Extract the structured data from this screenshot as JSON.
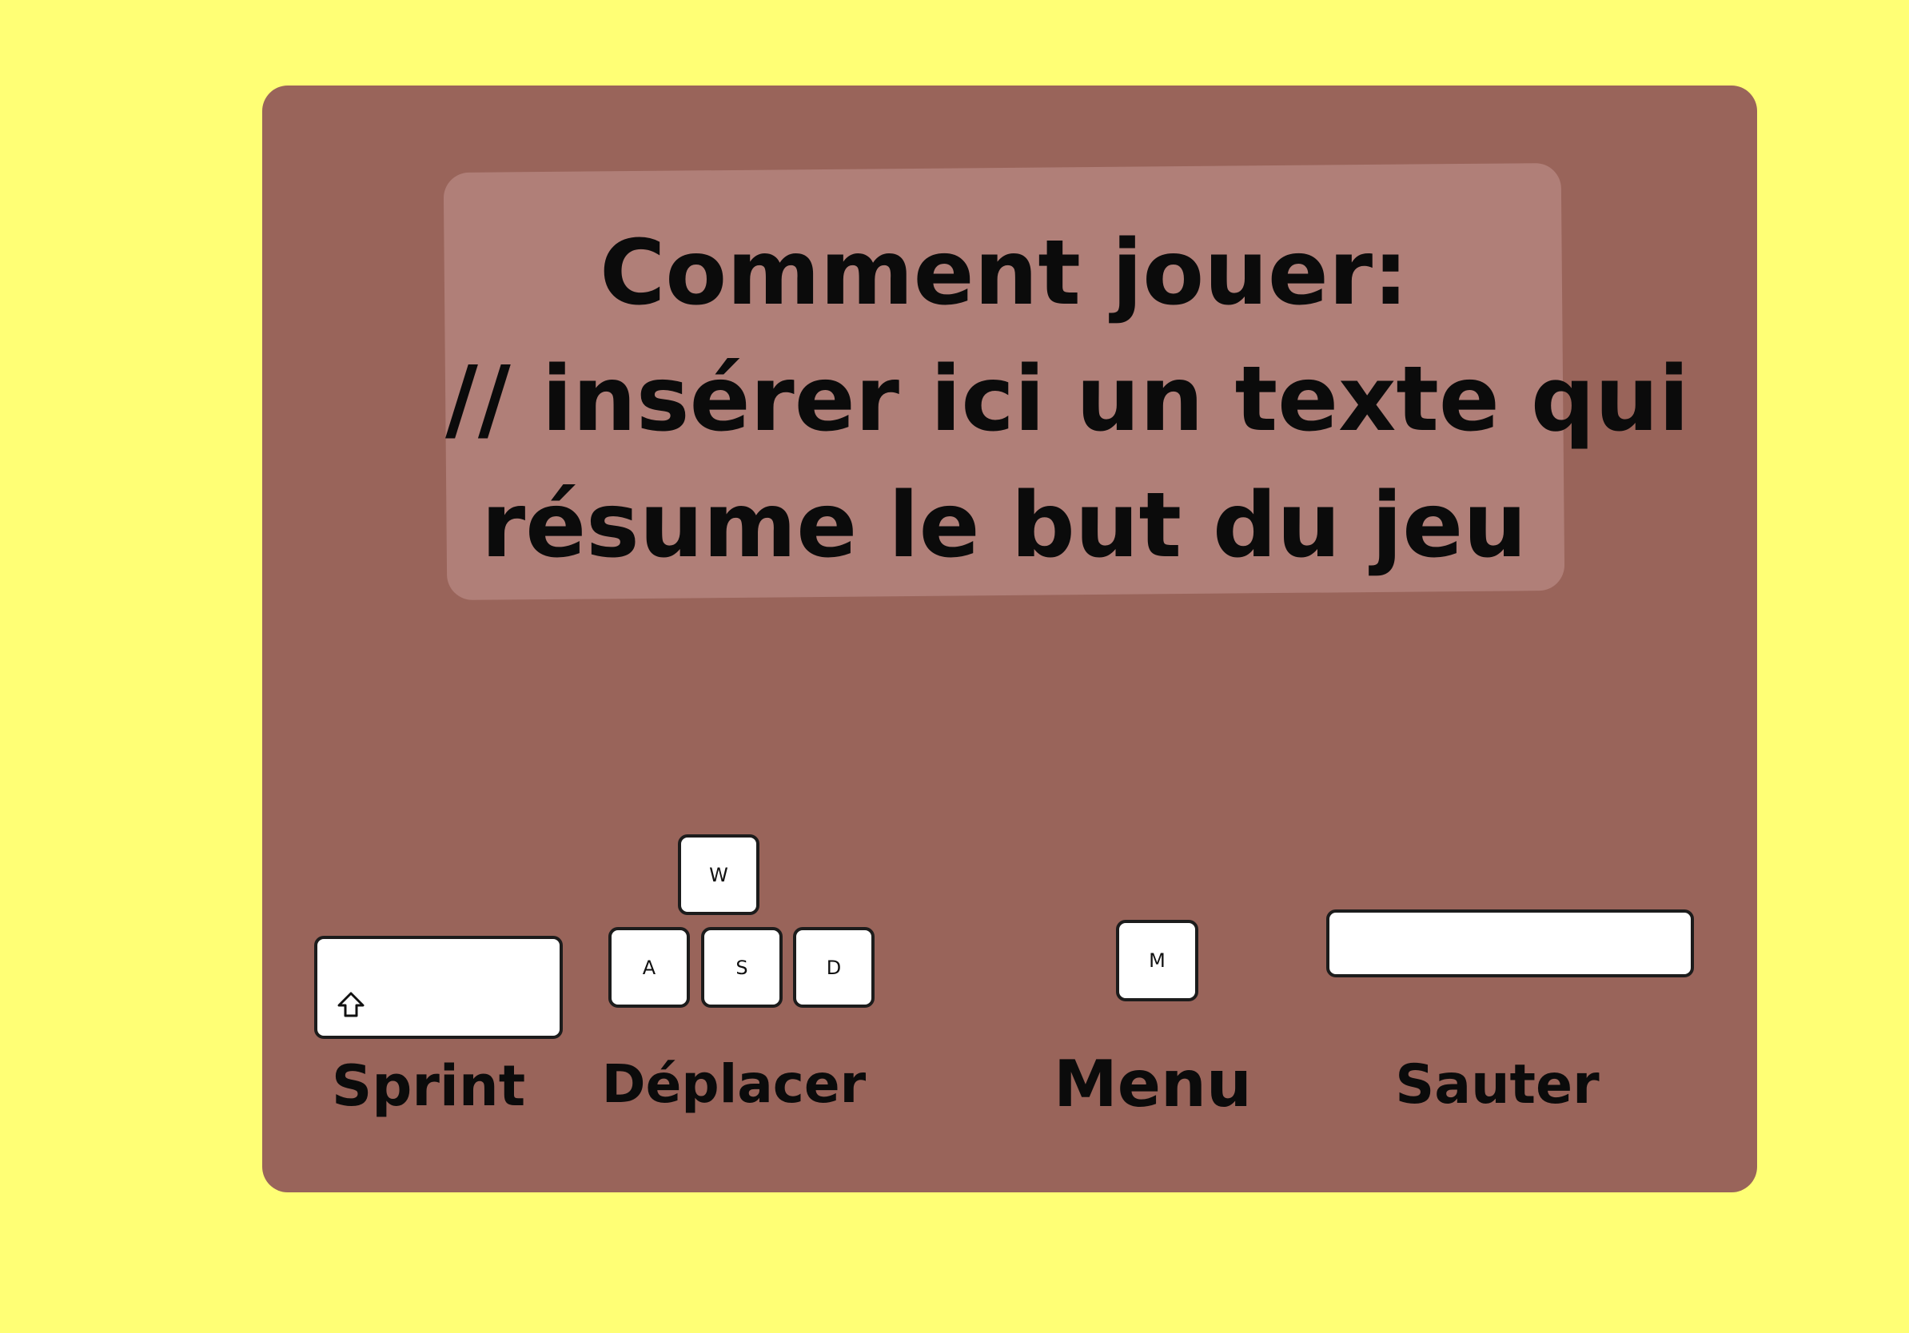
{
  "colors": {
    "background": "#FFFF75",
    "panel": "#99645A",
    "info_box": "#B07F78",
    "key_fill": "#FFFFFF",
    "text": "#0B0B0B"
  },
  "instructions": {
    "line1": "Comment jouer:",
    "line2": "// insérer ici un texte qui",
    "line3": "résume le but du jeu"
  },
  "keys": {
    "sprint_icon": "shift-arrow-icon",
    "w": "W",
    "a": "A",
    "s": "S",
    "d": "D",
    "m": "M",
    "space": ""
  },
  "labels": {
    "sprint": "Sprint",
    "move": "Déplacer",
    "menu": "Menu",
    "jump": "Sauter"
  }
}
